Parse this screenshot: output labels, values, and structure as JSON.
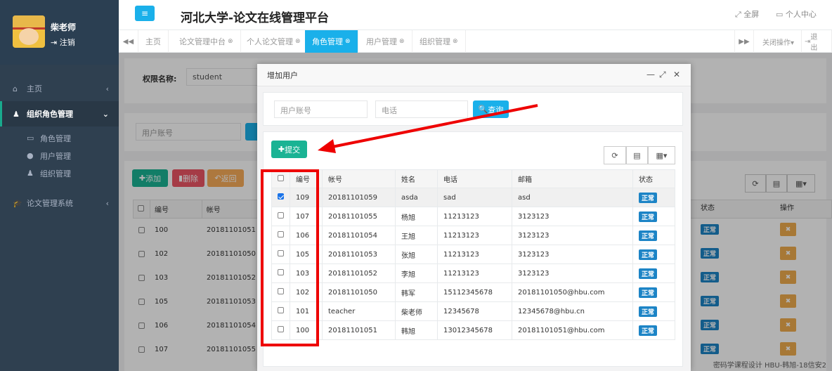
{
  "sidebar": {
    "user_name": "柴老师",
    "logout": "注销",
    "items": [
      {
        "icon": "home-icon",
        "label": "主页"
      },
      {
        "icon": "users-icon",
        "label": "组织角色管理"
      },
      {
        "icon": "graduation-cap-icon",
        "label": "论文管理系统"
      }
    ],
    "sub_items": [
      {
        "icon": "id-card-icon",
        "label": "角色管理"
      },
      {
        "icon": "user-circle-icon",
        "label": "用户管理"
      },
      {
        "icon": "group-icon",
        "label": "组织管理"
      }
    ]
  },
  "header": {
    "title": "河北大学-论文在线管理平台",
    "fullscreen": "全屏",
    "personal_center": "个人中心"
  },
  "tabs": [
    {
      "label": "主页",
      "closable": false
    },
    {
      "label": "论文管理中台",
      "closable": true
    },
    {
      "label": "个人论文管理",
      "closable": true
    },
    {
      "label": "角色管理",
      "closable": true,
      "active": true
    },
    {
      "label": "用户管理",
      "closable": true
    },
    {
      "label": "组织管理",
      "closable": true
    }
  ],
  "tab_actions": {
    "close_ops": "关闭操作▾",
    "exit": "退出"
  },
  "background": {
    "perm_label": "权限名称:",
    "perm_value": "student",
    "search_placeholder": "用户账号",
    "add": "添加",
    "delete": "删除",
    "back": "返回",
    "headers": [
      "编号",
      "帐号",
      "状态",
      "操作"
    ],
    "rows": [
      {
        "id": "100",
        "account": "20181101051"
      },
      {
        "id": "102",
        "account": "20181101050"
      },
      {
        "id": "103",
        "account": "20181101052"
      },
      {
        "id": "105",
        "account": "20181101053"
      },
      {
        "id": "106",
        "account": "20181101054"
      },
      {
        "id": "107",
        "account": "20181101055"
      }
    ],
    "status": "正常",
    "bottom_row": {
      "name": "杨旭",
      "phone": "11213123",
      "email": "3123123"
    }
  },
  "modal": {
    "title": "增加用户",
    "account_placeholder": "用户账号",
    "phone_placeholder": "电话",
    "query": "查询",
    "submit": "提交",
    "headers": [
      "编号",
      "帐号",
      "姓名",
      "电话",
      "邮箱",
      "状态"
    ],
    "rows": [
      {
        "id": "109",
        "account": "20181101059",
        "name": "asda",
        "phone": "sad",
        "email": "asd",
        "status": "正常",
        "checked": true
      },
      {
        "id": "107",
        "account": "20181101055",
        "name": "杨旭",
        "phone": "11213123",
        "email": "3123123",
        "status": "正常",
        "checked": false
      },
      {
        "id": "106",
        "account": "20181101054",
        "name": "王旭",
        "phone": "11213123",
        "email": "3123123",
        "status": "正常",
        "checked": false
      },
      {
        "id": "105",
        "account": "20181101053",
        "name": "张旭",
        "phone": "11213123",
        "email": "3123123",
        "status": "正常",
        "checked": false
      },
      {
        "id": "103",
        "account": "20181101052",
        "name": "李旭",
        "phone": "11213123",
        "email": "3123123",
        "status": "正常",
        "checked": false
      },
      {
        "id": "102",
        "account": "20181101050",
        "name": "韩军",
        "phone": "15112345678",
        "email": "20181101050@hbu.com",
        "status": "正常",
        "checked": false
      },
      {
        "id": "101",
        "account": "teacher",
        "name": "柴老师",
        "phone": "12345678",
        "email": "12345678@hbu.cn",
        "status": "正常",
        "checked": false
      },
      {
        "id": "100",
        "account": "20181101051",
        "name": "韩旭",
        "phone": "13012345678",
        "email": "20181101051@hbu.com",
        "status": "正常",
        "checked": false
      }
    ]
  },
  "footer": "密码学课程设计 HBU-韩旭-18信安2",
  "colors": {
    "sidebar": "#2f4050",
    "primary": "#1ab0ea",
    "green": "#1ab394",
    "annotation": "#e00000"
  }
}
